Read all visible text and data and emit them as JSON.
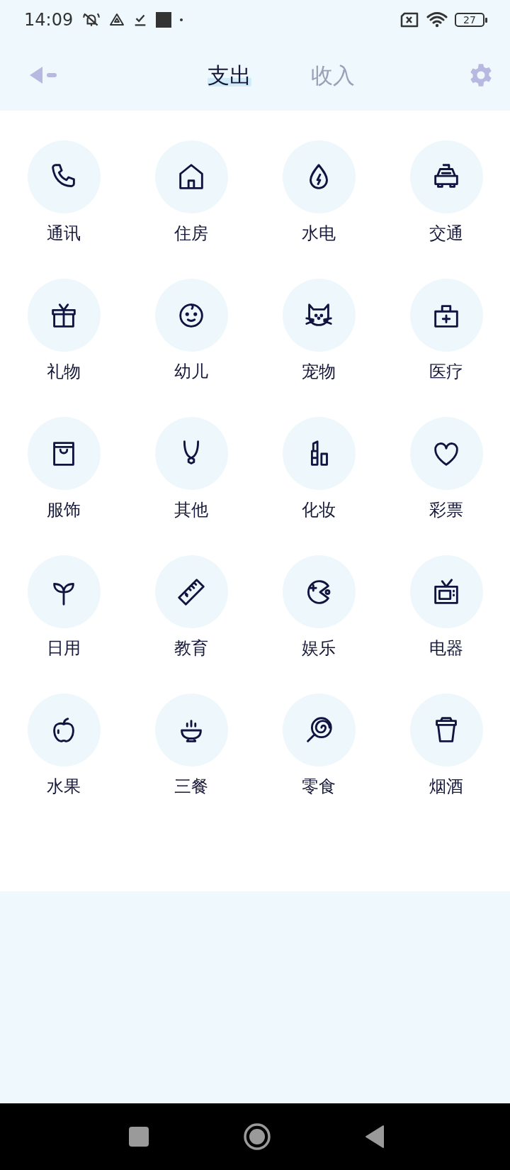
{
  "status_bar": {
    "time": "14:09",
    "battery": "27"
  },
  "tabs": [
    {
      "label": "支出",
      "selected": true
    },
    {
      "label": "收入",
      "selected": false
    }
  ],
  "categories": [
    {
      "label": "通讯"
    },
    {
      "label": "住房"
    },
    {
      "label": "水电"
    },
    {
      "label": "交通"
    },
    {
      "label": "礼物"
    },
    {
      "label": "幼儿"
    },
    {
      "label": "宠物"
    },
    {
      "label": "医疗"
    },
    {
      "label": "服饰"
    },
    {
      "label": "其他"
    },
    {
      "label": "化妆"
    },
    {
      "label": "彩票"
    },
    {
      "label": "日用"
    },
    {
      "label": "教育"
    },
    {
      "label": "娱乐"
    },
    {
      "label": "电器"
    },
    {
      "label": "水果"
    },
    {
      "label": "三餐"
    },
    {
      "label": "零食"
    },
    {
      "label": "烟酒"
    }
  ]
}
